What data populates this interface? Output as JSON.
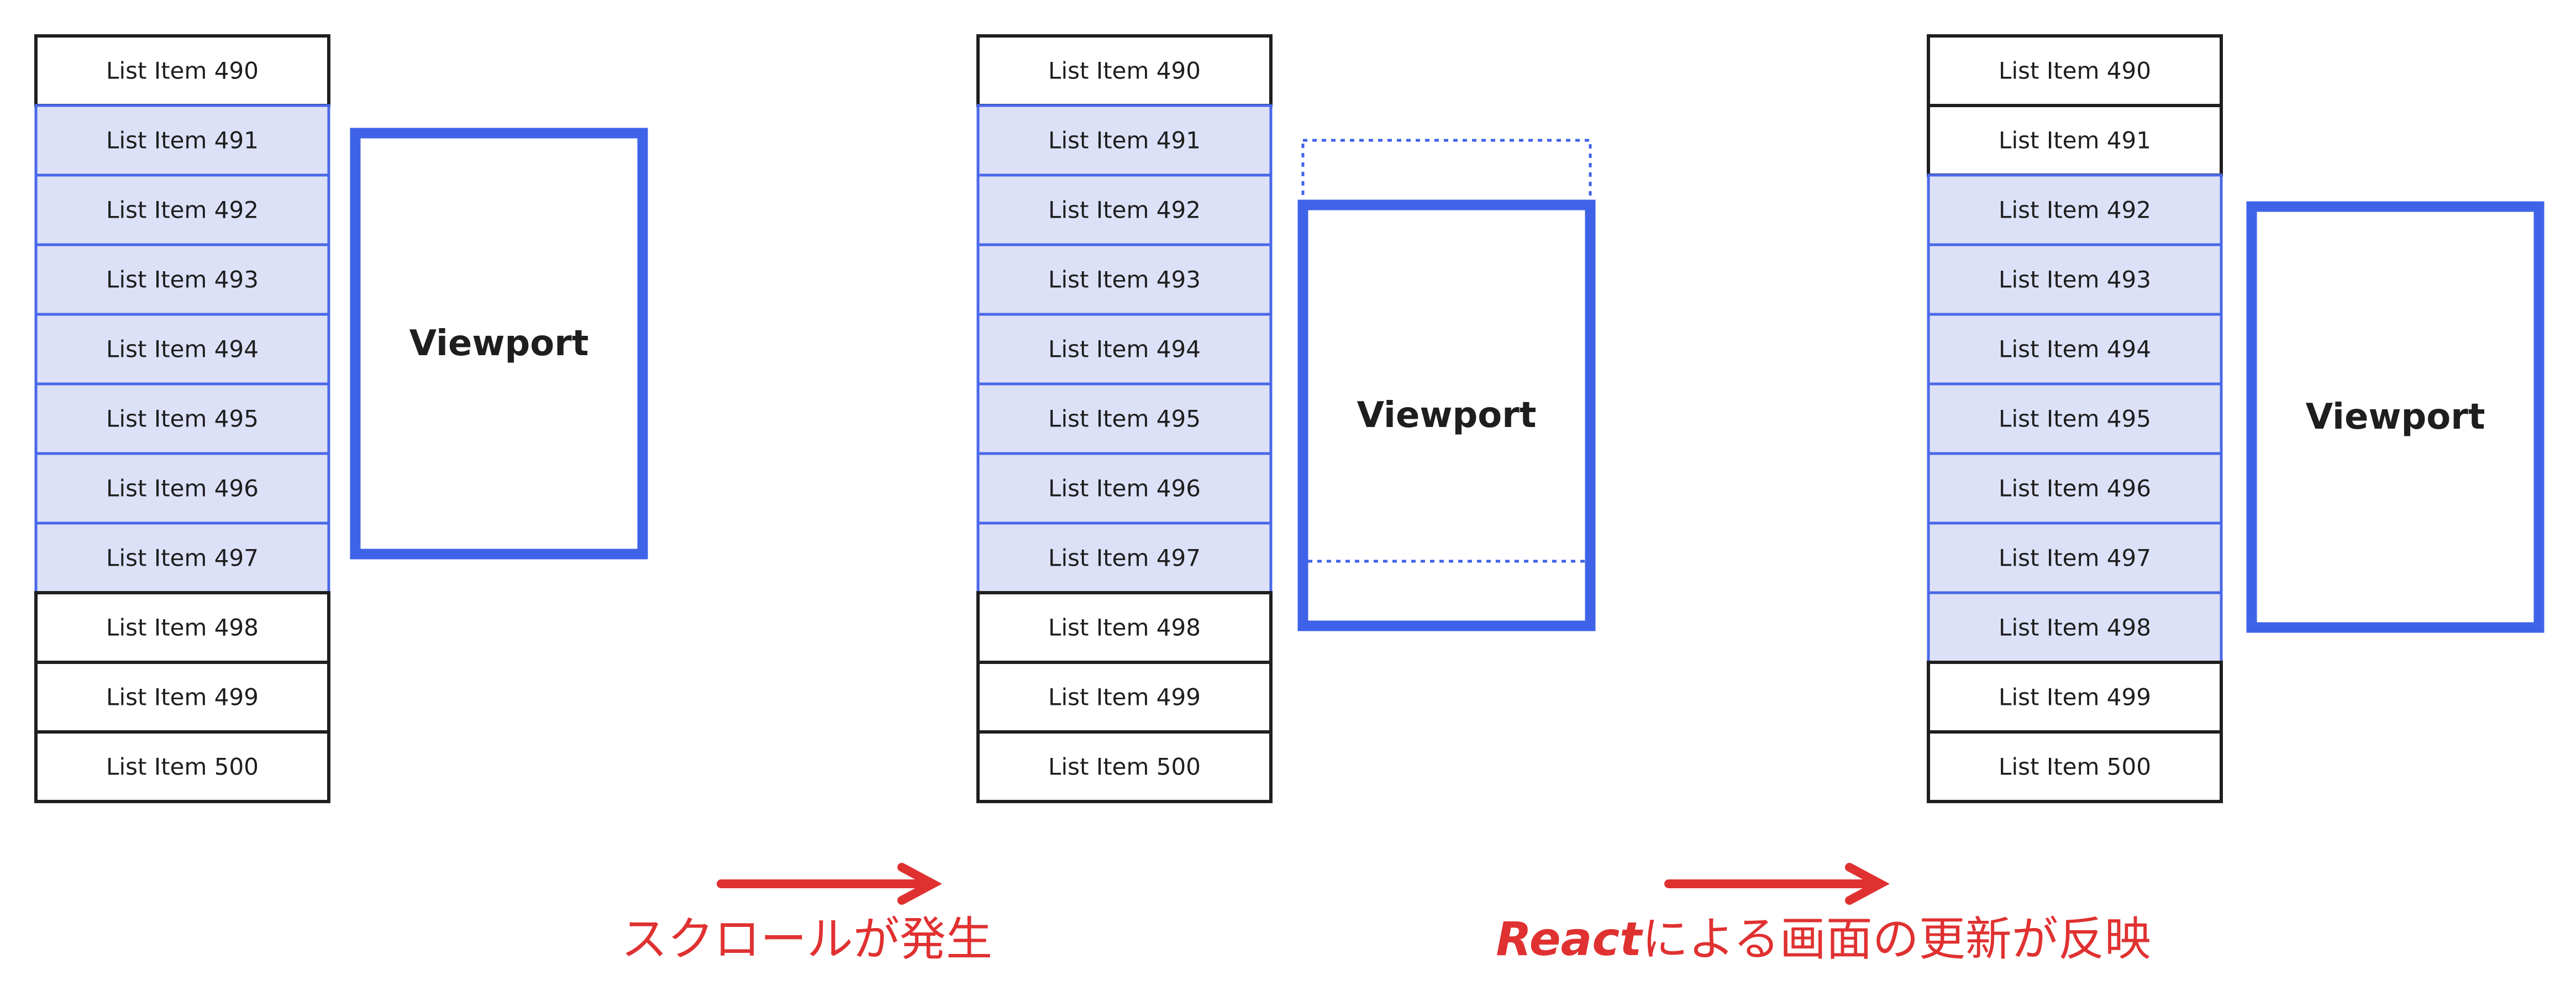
{
  "items": [
    "List Item 490",
    "List Item 491",
    "List Item 492",
    "List Item 493",
    "List Item 494",
    "List Item 495",
    "List Item 496",
    "List Item 497",
    "List Item 498",
    "List Item 499",
    "List Item 500"
  ],
  "panels": [
    {
      "highlighted": [
        "List Item 491",
        "List Item 492",
        "List Item 493",
        "List Item 494",
        "List Item 495",
        "List Item 496",
        "List Item 497"
      ],
      "viewport_label": "Viewport"
    },
    {
      "highlighted": [
        "List Item 491",
        "List Item 492",
        "List Item 493",
        "List Item 494",
        "List Item 495",
        "List Item 496",
        "List Item 497"
      ],
      "viewport_label": "Viewport"
    },
    {
      "highlighted": [
        "List Item 492",
        "List Item 493",
        "List Item 494",
        "List Item 495",
        "List Item 496",
        "List Item 497",
        "List Item 498"
      ],
      "viewport_label": "Viewport"
    }
  ],
  "captions": {
    "scroll": "スクロールが発生",
    "react_strong": "React",
    "react_rest": "による画面の更新が反映"
  },
  "colors": {
    "highlight_fill": "#dde1f8",
    "highlight_stroke": "#4a68e8",
    "viewport": "#3f63e8",
    "arrow": "#e03131"
  }
}
